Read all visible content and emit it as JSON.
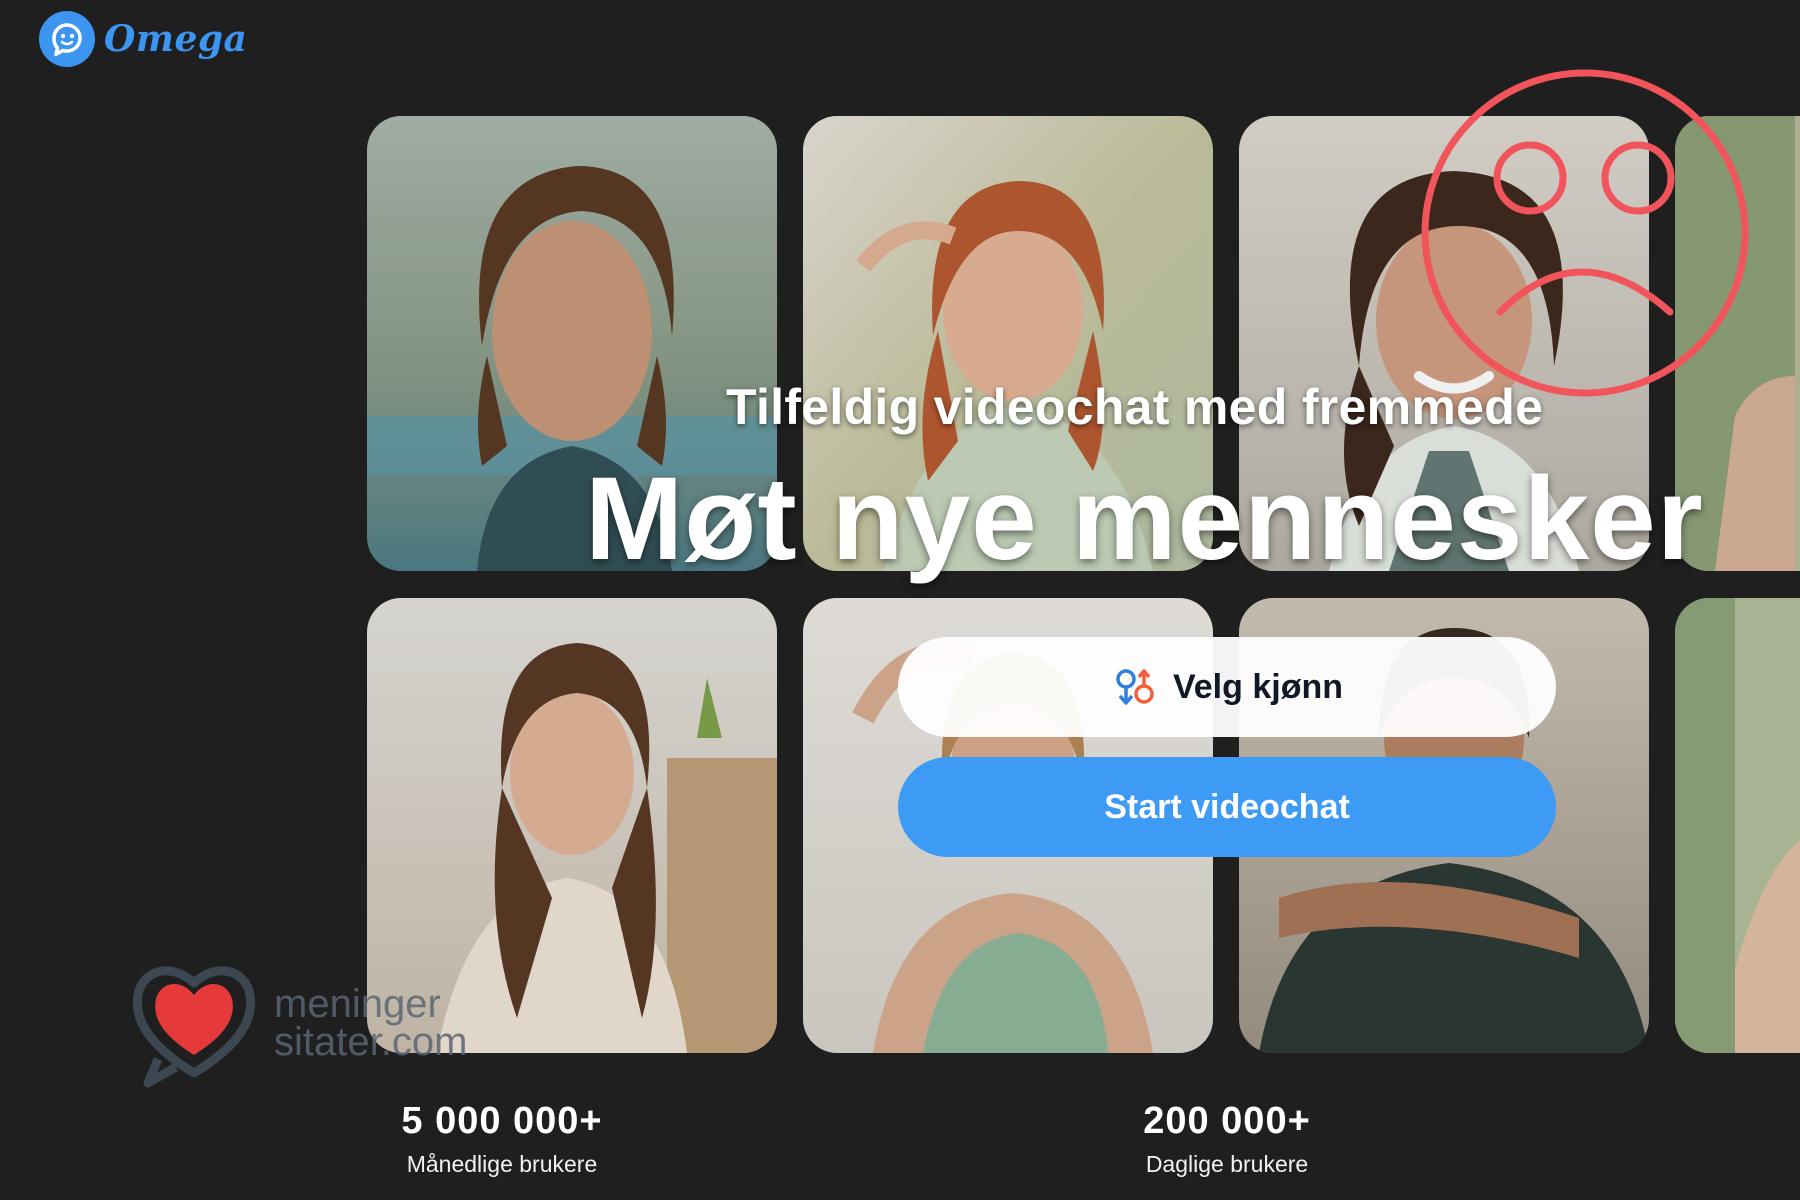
{
  "header": {
    "logo_text": "Omega",
    "logo_icon": "chat-bubble-smiley-icon",
    "brand_color": "#3d95f2"
  },
  "hero": {
    "subtitle": "Tilfeldig videochat med fremmede",
    "headline": "Møt nye mennesker"
  },
  "actions": {
    "gender_button_label": "Velg kjønn",
    "gender_icon": "gender-symbols-icon",
    "start_button_label": "Start videochat",
    "start_button_color": "#3d9af5"
  },
  "stats": [
    {
      "value": "5 000 000+",
      "label": "Månedlige brukere"
    },
    {
      "value": "200 000+",
      "label": "Daglige brukere"
    }
  ],
  "overlay": {
    "sad_face_icon": "sad-face-icon",
    "sad_face_color": "#f2545b"
  },
  "watermark": {
    "line1": "meninger",
    "line2": "sitater.com",
    "icon": "heart-speech-bubble-icon"
  },
  "photo_grid": {
    "photos": [
      "man-long-hair-photo",
      "woman-red-hair-photo",
      "woman-smiling-curly-hair-photo",
      "partial-photo-top-right",
      "woman-long-brown-hair-photo",
      "woman-green-top-photo",
      "man-crossed-arms-photo",
      "partial-photo-bottom-right"
    ]
  }
}
